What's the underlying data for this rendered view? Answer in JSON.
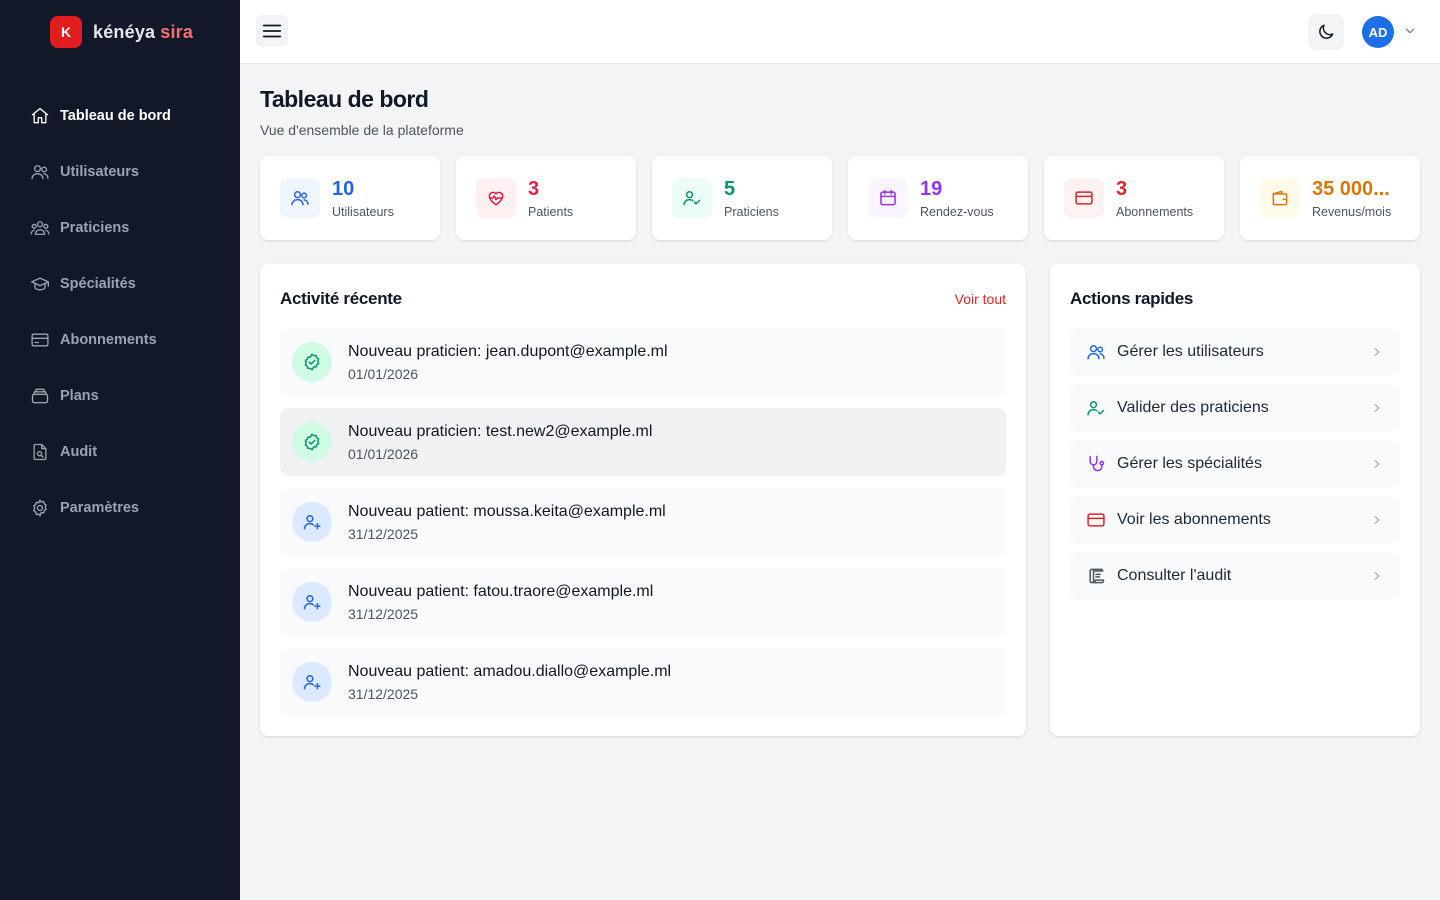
{
  "brand": {
    "logo_letter": "K",
    "name_primary": "kénéya",
    "name_accent": "sira"
  },
  "sidebar": {
    "items": [
      {
        "label": "Tableau de bord",
        "icon": "home-icon",
        "active": true
      },
      {
        "label": "Utilisateurs",
        "icon": "users-icon",
        "active": false
      },
      {
        "label": "Praticiens",
        "icon": "user-group-icon",
        "active": false
      },
      {
        "label": "Spécialités",
        "icon": "graduation-cap-icon",
        "active": false
      },
      {
        "label": "Abonnements",
        "icon": "credit-card-icon",
        "active": false
      },
      {
        "label": "Plans",
        "icon": "layers-icon",
        "active": false
      },
      {
        "label": "Audit",
        "icon": "document-search-icon",
        "active": false
      },
      {
        "label": "Paramètres",
        "icon": "gear-icon",
        "active": false
      }
    ]
  },
  "header": {
    "menu_icon": "hamburger-icon",
    "theme_icon": "moon-icon",
    "avatar_initials": "AD"
  },
  "page": {
    "title": "Tableau de bord",
    "subtitle": "Vue d'ensemble de la plateforme"
  },
  "stats": [
    {
      "value": "10",
      "label": "Utilisateurs",
      "icon": "users-icon",
      "color": "#2563eb",
      "bg": "#eff6ff"
    },
    {
      "value": "3",
      "label": "Patients",
      "icon": "heart-pulse-icon",
      "color": "#e11d48",
      "bg": "#fff1f2"
    },
    {
      "value": "5",
      "label": "Praticiens",
      "icon": "user-check-icon",
      "color": "#059669",
      "bg": "#ecfdf5"
    },
    {
      "value": "19",
      "label": "Rendez-vous",
      "icon": "calendar-icon",
      "color": "#9333ea",
      "bg": "#faf5ff"
    },
    {
      "value": "3",
      "label": "Abonnements",
      "icon": "credit-card-icon",
      "color": "#dc2626",
      "bg": "#fef2f2"
    },
    {
      "value": "35 000...",
      "label": "Revenus/mois",
      "icon": "wallet-icon",
      "color": "#d97706",
      "bg": "#fffbeb"
    }
  ],
  "activity": {
    "title": "Activité récente",
    "see_all": "Voir tout",
    "items": [
      {
        "title": "Nouveau praticien: jean.dupont@example.ml",
        "date": "01/01/2026",
        "icon": "check-badge-icon",
        "color": "#059669",
        "bg": "#d1fae5"
      },
      {
        "title": "Nouveau praticien: test.new2@example.ml",
        "date": "01/01/2026",
        "icon": "check-badge-icon",
        "color": "#059669",
        "bg": "#d1fae5"
      },
      {
        "title": "Nouveau patient: moussa.keita@example.ml",
        "date": "31/12/2025",
        "icon": "user-plus-icon",
        "color": "#2563eb",
        "bg": "#dbeafe"
      },
      {
        "title": "Nouveau patient: fatou.traore@example.ml",
        "date": "31/12/2025",
        "icon": "user-plus-icon",
        "color": "#2563eb",
        "bg": "#dbeafe"
      },
      {
        "title": "Nouveau patient: amadou.diallo@example.ml",
        "date": "31/12/2025",
        "icon": "user-plus-icon",
        "color": "#2563eb",
        "bg": "#dbeafe"
      }
    ]
  },
  "quick_actions": {
    "title": "Actions rapides",
    "items": [
      {
        "label": "Gérer les utilisateurs",
        "icon": "users-icon",
        "color": "#2563eb"
      },
      {
        "label": "Valider des praticiens",
        "icon": "user-check-icon",
        "color": "#059669"
      },
      {
        "label": "Gérer les spécialités",
        "icon": "stethoscope-icon",
        "color": "#9333ea"
      },
      {
        "label": "Voir les abonnements",
        "icon": "credit-card-icon",
        "color": "#dc2626"
      },
      {
        "label": "Consulter l'audit",
        "icon": "scroll-icon",
        "color": "#4b5563"
      }
    ]
  }
}
